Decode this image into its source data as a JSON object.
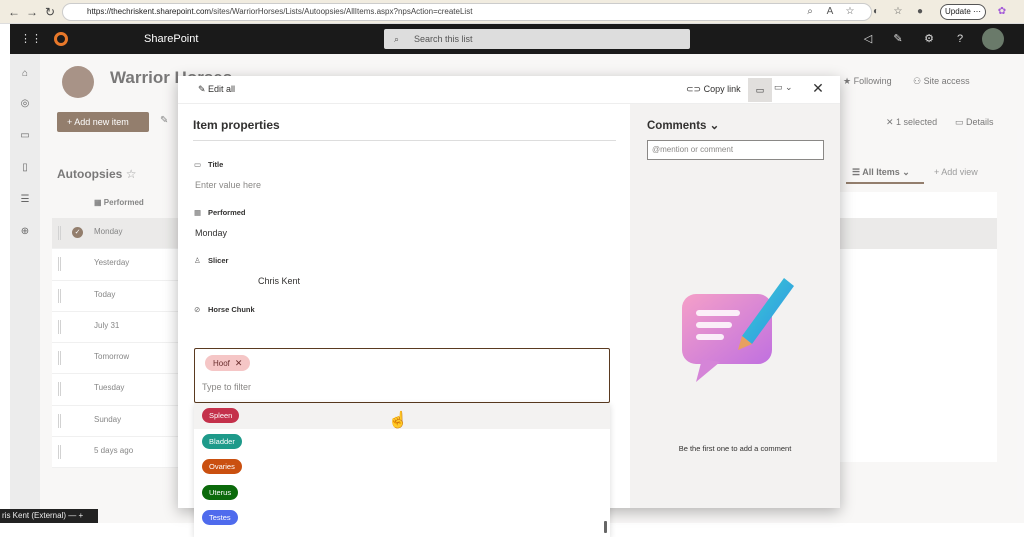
{
  "browser": {
    "url_host": "https://thechriskent.sharepoint.com",
    "url_path": "/sites/WarriorHorses/Lists/Autoopsies/AllItems.aspx?npsAction=createList",
    "update_label": "Update",
    "back_icon": "arrow-left-icon",
    "forward_icon": "arrow-right-icon",
    "refresh_icon": "refresh-icon"
  },
  "suite": {
    "brand": "aperture",
    "app_label": "SharePoint",
    "search_placeholder": "Search this list"
  },
  "site": {
    "title": "Warrior Horses",
    "following_label": "Following",
    "site_access_label": "Site access"
  },
  "commandbar": {
    "add_new_label": "Add new item",
    "selected_label": "1 selected",
    "details_label": "Details"
  },
  "list": {
    "name": "Autoopsies",
    "column_header": "Performed",
    "rows": [
      "Monday",
      "Yesterday",
      "Today",
      "July 31",
      "Tomorrow",
      "Tuesday",
      "Sunday",
      "5 days ago"
    ],
    "view_label": "All Items",
    "add_view_label": "Add view"
  },
  "modal": {
    "edit_all_label": "Edit all",
    "copy_link_label": "Copy link",
    "pane_title": "Item properties",
    "fields": {
      "title": {
        "label": "Title",
        "placeholder": "Enter value here"
      },
      "performed": {
        "label": "Performed",
        "value": "Monday"
      },
      "slicer": {
        "label": "Slicer",
        "value": "Chris Kent"
      },
      "horse_chunk": {
        "label": "Horse Chunk",
        "selected_chip": "Hoof",
        "filter_placeholder": "Type to filter"
      }
    },
    "options": [
      {
        "label": "Spleen",
        "color": "#c4314b"
      },
      {
        "label": "Bladder",
        "color": "#1e9a8a"
      },
      {
        "label": "Ovaries",
        "color": "#ca5010"
      },
      {
        "label": "Uterus",
        "color": "#0b6a0b"
      },
      {
        "label": "Testes",
        "color": "#4f6bed"
      }
    ]
  },
  "comments": {
    "title": "Comments",
    "input_placeholder": "@mention or comment",
    "empty_message": "Be the first one to add a comment"
  },
  "footer": {
    "external_label": "ris Kent (External)"
  },
  "colors": {
    "brand": "#5a3a20",
    "suite_bg": "#1a1a1a",
    "logo": "#e8782a"
  }
}
